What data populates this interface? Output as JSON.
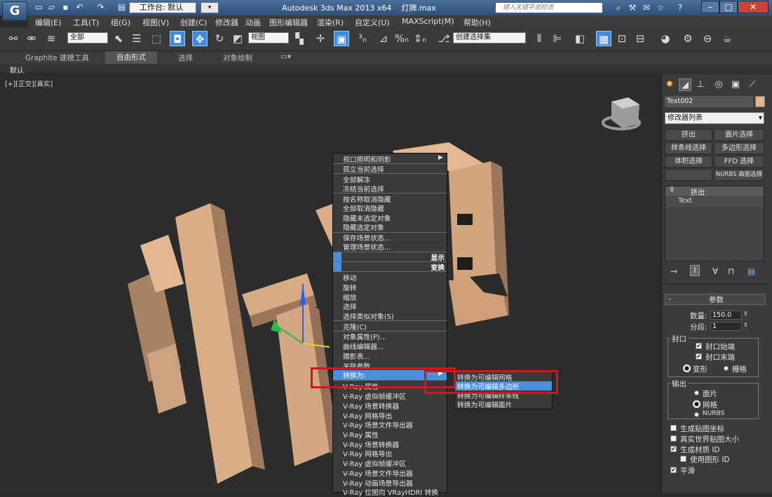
{
  "app": {
    "title": "Autodesk 3ds Max  2013 x64",
    "file": "灯牌.max",
    "workspace_label": "工作台: 默认",
    "search_placeholder": "键入关键字或短语",
    "accent": "#3d8ce0",
    "highlight": "#e0101a"
  },
  "menubar": [
    "编辑(E)",
    "工具(T)",
    "组(G)",
    "视图(V)",
    "创建(C)",
    "修改器",
    "动画",
    "图形编辑器",
    "渲染(R)",
    "自定义(U)",
    "MAXScript(M)",
    "帮助(H)"
  ],
  "toolbar": {
    "filter": "全部",
    "refcoord": "视图",
    "selection_set": "创建选择集"
  },
  "ribbon": {
    "tabs": [
      "Graphite 建模工具",
      "自由形式",
      "选择",
      "对象绘制"
    ],
    "active": "自由形式",
    "sub": "默认"
  },
  "viewport": {
    "label": "[+][正交][真实]",
    "text3d": "灯牌"
  },
  "context_menu": {
    "top": [
      "视口照明和阴影",
      "孤立当前选择",
      "全部解冻",
      "冻结当前选择",
      "按名称取消隐藏",
      "全部取消隐藏",
      "隐藏未选定对象",
      "隐藏选定对象",
      "保存场景状态...",
      "管理场景状态..."
    ],
    "headers": [
      "显示",
      "变换"
    ],
    "transform": [
      "移动",
      "旋转",
      "缩放",
      "选择",
      "选择类似对象(S)",
      "克隆(C)",
      "对象属性(P)...",
      "曲线编辑器...",
      "摄影表...",
      "关联参数",
      "转换为:"
    ],
    "vray": [
      "V-Ray 属性",
      "V-Ray 虚拟帧缓冲区",
      "V-Ray 场景转换器",
      "V-Ray 网格导出",
      "V-Ray 场景文件导出器",
      "V-Ray 属性",
      "V-Ray 场景转换器",
      "V-Ray 网格导出",
      "V-Ray 虚拟帧缓冲区",
      "V-Ray 场景文件导出器",
      "V-Ray 动画场景导出器",
      "V-Ray 位图向 VRayHDRI 转换"
    ]
  },
  "submenu": [
    "转换为可编辑网格",
    "转换为可编辑多边形",
    "转换为可编辑样条线",
    "转换为可编辑面片"
  ],
  "command_panel": {
    "object_name": "Text002",
    "color": "#e9b48a",
    "modifier_list": "修改器列表",
    "modifier_buttons": [
      "挤出",
      "面片选择",
      "样条线选择",
      "多边形选择",
      "体积选择",
      "FFD 选择",
      "NURBS 曲面选择"
    ],
    "stack": [
      "挤出",
      "Text"
    ],
    "params": {
      "title": "参数",
      "amount_label": "数量:",
      "amount": "150.0",
      "segments_label": "分段:",
      "segments": "1",
      "capping": "封口",
      "cap_start": "封口始端",
      "cap_end": "封口末端",
      "morph": "变形",
      "grid": "栅格",
      "output": "输出",
      "patch": "面片",
      "mesh": "网格",
      "nurbs": "NURBS",
      "gen_map": "生成贴图坐标",
      "real_world": "真实世界贴图大小",
      "gen_mat": "生成材质 ID",
      "use_shape": "使用图形 ID",
      "smooth": "平滑"
    }
  }
}
